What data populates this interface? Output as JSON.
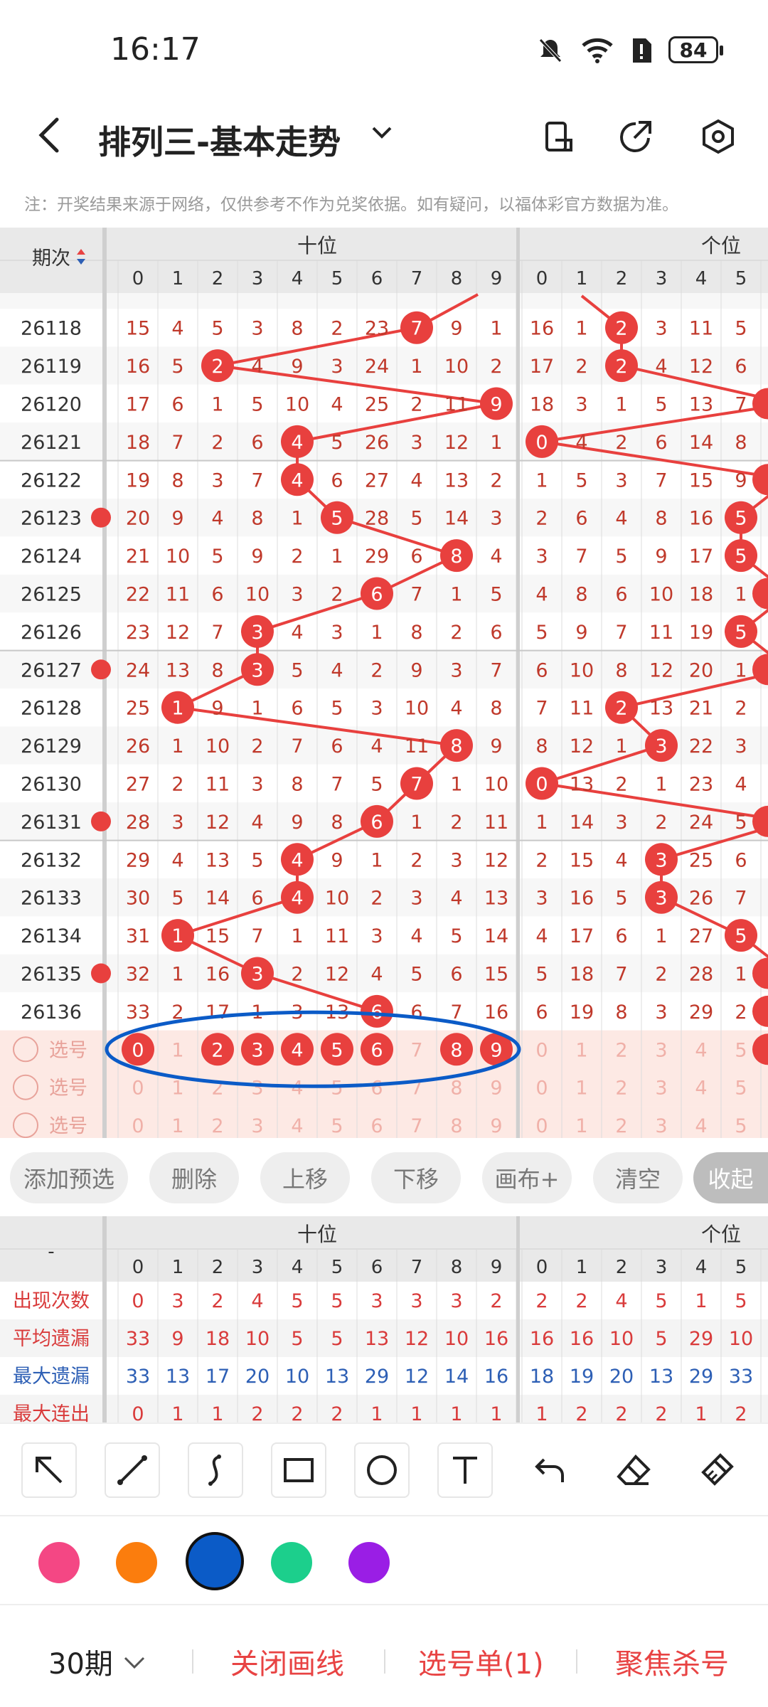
{
  "status": {
    "time": "16:17",
    "battery": "84"
  },
  "header": {
    "title": "排列三-基本走势"
  },
  "note": "注：开奖结果来源于网络，仅供参考不作为兑奖依据。如有疑问，以福体彩官方数据为准。",
  "grid": {
    "period_header": "期次",
    "group1": "十位",
    "group2": "个位",
    "digits_ten": [
      "0",
      "1",
      "2",
      "3",
      "4",
      "5",
      "6",
      "7",
      "8",
      "9"
    ],
    "digits_one": [
      "0",
      "1",
      "2",
      "3",
      "4",
      "5"
    ],
    "rows": [
      {
        "period": "26118",
        "ten": [
          "15",
          "4",
          "5",
          "3",
          "8",
          "2",
          "23",
          "7",
          "9",
          "1"
        ],
        "one": [
          "16",
          "1",
          "2",
          "3",
          "11",
          "5"
        ],
        "hitT": 7,
        "hitO": 2
      },
      {
        "period": "26119",
        "ten": [
          "16",
          "5",
          "2",
          "4",
          "9",
          "3",
          "24",
          "1",
          "10",
          "2"
        ],
        "one": [
          "17",
          "2",
          "2",
          "4",
          "12",
          "6"
        ],
        "hitT": 2,
        "hitO": 2
      },
      {
        "period": "26120",
        "ten": [
          "17",
          "6",
          "1",
          "5",
          "10",
          "4",
          "25",
          "2",
          "11",
          "9"
        ],
        "one": [
          "18",
          "3",
          "1",
          "5",
          "13",
          "7"
        ],
        "hitT": 9,
        "hitO": -1
      },
      {
        "period": "26121",
        "ten": [
          "18",
          "7",
          "2",
          "6",
          "4",
          "5",
          "26",
          "3",
          "12",
          "1"
        ],
        "one": [
          "0",
          "4",
          "2",
          "6",
          "14",
          "8"
        ],
        "hitT": 4,
        "hitO": 0
      },
      {
        "period": "26122",
        "ten": [
          "19",
          "8",
          "3",
          "7",
          "4",
          "6",
          "27",
          "4",
          "13",
          "2"
        ],
        "one": [
          "1",
          "5",
          "3",
          "7",
          "15",
          "9"
        ],
        "hitT": 4,
        "hitO": -1
      },
      {
        "period": "26123",
        "ten": [
          "20",
          "9",
          "4",
          "8",
          "1",
          "5",
          "28",
          "5",
          "14",
          "3"
        ],
        "one": [
          "2",
          "6",
          "4",
          "8",
          "16",
          "5"
        ],
        "hitT": 5,
        "hitO": 5
      },
      {
        "period": "26124",
        "ten": [
          "21",
          "10",
          "5",
          "9",
          "2",
          "1",
          "29",
          "6",
          "8",
          "4"
        ],
        "one": [
          "3",
          "7",
          "5",
          "9",
          "17",
          "5"
        ],
        "hitT": 8,
        "hitO": 5
      },
      {
        "period": "26125",
        "ten": [
          "22",
          "11",
          "6",
          "10",
          "3",
          "2",
          "6",
          "7",
          "1",
          "5"
        ],
        "one": [
          "4",
          "8",
          "6",
          "10",
          "18",
          "1"
        ],
        "hitT": 6,
        "hitO": -1
      },
      {
        "period": "26126",
        "ten": [
          "23",
          "12",
          "7",
          "3",
          "4",
          "3",
          "1",
          "8",
          "2",
          "6"
        ],
        "one": [
          "5",
          "9",
          "7",
          "11",
          "19",
          "5"
        ],
        "hitT": 3,
        "hitO": 5
      },
      {
        "period": "26127",
        "ten": [
          "24",
          "13",
          "8",
          "3",
          "5",
          "4",
          "2",
          "9",
          "3",
          "7"
        ],
        "one": [
          "6",
          "10",
          "8",
          "12",
          "20",
          "1"
        ],
        "hitT": 3,
        "hitO": -1
      },
      {
        "period": "26128",
        "ten": [
          "25",
          "1",
          "9",
          "1",
          "6",
          "5",
          "3",
          "10",
          "4",
          "8"
        ],
        "one": [
          "7",
          "11",
          "2",
          "13",
          "21",
          "2"
        ],
        "hitT": 1,
        "hitO": 2
      },
      {
        "period": "26129",
        "ten": [
          "26",
          "1",
          "10",
          "2",
          "7",
          "6",
          "4",
          "11",
          "8",
          "9"
        ],
        "one": [
          "8",
          "12",
          "1",
          "3",
          "22",
          "3"
        ],
        "hitT": 8,
        "hitO": 3
      },
      {
        "period": "26130",
        "ten": [
          "27",
          "2",
          "11",
          "3",
          "8",
          "7",
          "5",
          "7",
          "1",
          "10"
        ],
        "one": [
          "0",
          "13",
          "2",
          "1",
          "23",
          "4"
        ],
        "hitT": 7,
        "hitO": 0
      },
      {
        "period": "26131",
        "ten": [
          "28",
          "3",
          "12",
          "4",
          "9",
          "8",
          "6",
          "1",
          "2",
          "11"
        ],
        "one": [
          "1",
          "14",
          "3",
          "2",
          "24",
          "5"
        ],
        "hitT": 6,
        "hitO": -1
      },
      {
        "period": "26132",
        "ten": [
          "29",
          "4",
          "13",
          "5",
          "4",
          "9",
          "1",
          "2",
          "3",
          "12"
        ],
        "one": [
          "2",
          "15",
          "4",
          "3",
          "25",
          "6"
        ],
        "hitT": 4,
        "hitO": 3
      },
      {
        "period": "26133",
        "ten": [
          "30",
          "5",
          "14",
          "6",
          "4",
          "10",
          "2",
          "3",
          "4",
          "13"
        ],
        "one": [
          "3",
          "16",
          "5",
          "3",
          "26",
          "7"
        ],
        "hitT": 4,
        "hitO": 3
      },
      {
        "period": "26134",
        "ten": [
          "31",
          "1",
          "15",
          "7",
          "1",
          "11",
          "3",
          "4",
          "5",
          "14"
        ],
        "one": [
          "4",
          "17",
          "6",
          "1",
          "27",
          "5"
        ],
        "hitT": 1,
        "hitO": 5
      },
      {
        "period": "26135",
        "ten": [
          "32",
          "1",
          "16",
          "3",
          "2",
          "12",
          "4",
          "5",
          "6",
          "15"
        ],
        "one": [
          "5",
          "18",
          "7",
          "2",
          "28",
          "1"
        ],
        "hitT": 3,
        "hitO": -1
      },
      {
        "period": "26136",
        "ten": [
          "33",
          "2",
          "17",
          "1",
          "3",
          "13",
          "6",
          "6",
          "7",
          "16"
        ],
        "one": [
          "6",
          "19",
          "8",
          "3",
          "29",
          "2"
        ],
        "hitT": 6,
        "hitO": -1
      }
    ],
    "pick_label": "选号",
    "pick_ten_selected": [
      0,
      2,
      3,
      4,
      5,
      6,
      8,
      9
    ]
  },
  "buttons": [
    "添加预选",
    "删除",
    "上移",
    "下移",
    "画布+",
    "清空",
    "收起"
  ],
  "stats": {
    "corner": "-",
    "group1": "十位",
    "group2": "个位",
    "rows": [
      {
        "label": "出现次数",
        "color": "#d93b3b",
        "ten": [
          "0",
          "3",
          "2",
          "4",
          "5",
          "5",
          "3",
          "3",
          "3",
          "2"
        ],
        "one": [
          "2",
          "2",
          "4",
          "5",
          "1",
          "5"
        ]
      },
      {
        "label": "平均遗漏",
        "color": "#d93b3b",
        "ten": [
          "33",
          "9",
          "18",
          "10",
          "5",
          "5",
          "13",
          "12",
          "10",
          "16"
        ],
        "one": [
          "16",
          "16",
          "10",
          "5",
          "29",
          "10"
        ]
      },
      {
        "label": "最大遗漏",
        "color": "#2d5fb5",
        "ten": [
          "33",
          "13",
          "17",
          "20",
          "10",
          "13",
          "29",
          "12",
          "14",
          "16"
        ],
        "one": [
          "18",
          "19",
          "20",
          "13",
          "29",
          "33"
        ]
      },
      {
        "label": "最大连出",
        "color": "#d93b3b",
        "ten": [
          "0",
          "1",
          "1",
          "2",
          "2",
          "2",
          "1",
          "1",
          "1",
          "1"
        ],
        "one": [
          "1",
          "2",
          "2",
          "2",
          "1",
          "2"
        ]
      }
    ]
  },
  "tools": [
    "arrow-icon",
    "line-icon",
    "curve-icon",
    "rectangle-icon",
    "circle-icon",
    "text-icon",
    "undo-icon",
    "eraser-icon",
    "clear-icon"
  ],
  "colors": [
    "#f44784",
    "#fb7d0d",
    "#0b5bc7",
    "#1ccf8c",
    "#9a1ee5"
  ],
  "selected_color": "#0b5bc7",
  "bottom": {
    "period": "30期",
    "close_line": "关闭画线",
    "ticket": "选号单(1)",
    "focus": "聚焦杀号"
  }
}
